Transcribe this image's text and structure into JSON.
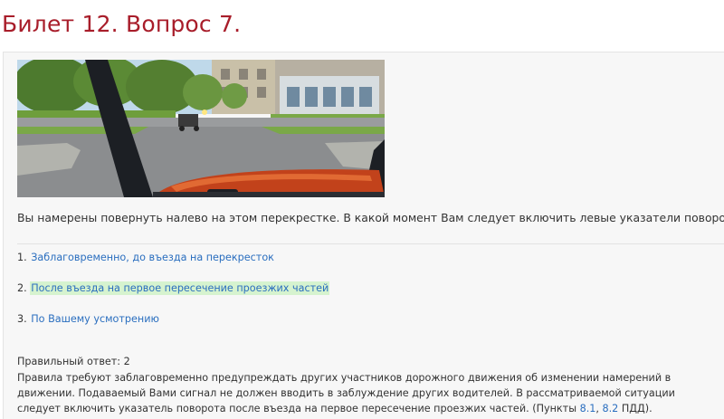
{
  "title": "Билет 12. Вопрос 7.",
  "question": "Вы намерены повернуть налево на этом перекрестке. В какой момент Вам следует включить левые указатели поворота?",
  "answers": [
    {
      "num": "1.",
      "text": "Заблаговременно, до въезда на перекресток",
      "highlighted": false
    },
    {
      "num": "2.",
      "text": "После въезда на первое пересечение проезжих частей",
      "highlighted": true
    },
    {
      "num": "3.",
      "text": "По Вашему усмотрению",
      "highlighted": false
    }
  ],
  "correct_answer": "Правильный ответ: 2",
  "explanation": {
    "text": "Правила требуют заблаговременно предупреждать других участников дорожного движения об изменении намерений в движении. Подаваемый Вами сигнал не должен вводить в заблуждение других водителей. В рассматриваемой ситуации следует включить указатель поворота после въезда на первое пересечение проезжих частей. (Пункты ",
    "ref1": "8.1",
    "sep": ", ",
    "ref2": "8.2",
    "suffix": " ПДД)."
  },
  "colors": {
    "title": "#a81d2a",
    "link": "#2a6ebf",
    "highlight": "#d6f3cf"
  }
}
